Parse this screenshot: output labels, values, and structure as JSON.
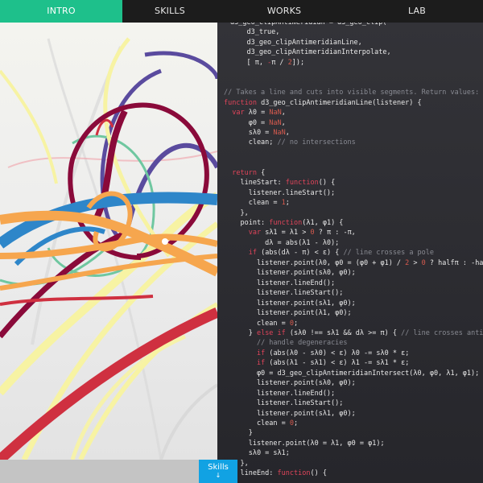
{
  "nav": {
    "tabs": [
      {
        "label": "INTRO",
        "active": true
      },
      {
        "label": "SKILLS",
        "active": false
      },
      {
        "label": "WORKS",
        "active": false
      },
      {
        "label": "LAB",
        "active": false
      }
    ],
    "active_color": "#1ec08b"
  },
  "colors": {
    "comment": "#888a92",
    "keyword": "#e0445a",
    "number": "#d65a4e",
    "default": "#e8e8e8",
    "palette": [
      "#8a0a3a",
      "#2e86c9",
      "#5a4b9e",
      "#f6a64e",
      "#f7f3a3",
      "#d9d9d9",
      "#cf3040",
      "#6fc7a0",
      "#f0a0a8"
    ]
  },
  "code_lines": [
    [
      [
        "default",
        "d3_geo_clipAntimeridian = d3_geo_clip("
      ]
    ],
    [
      [
        "default",
        "    d3_true,"
      ]
    ],
    [
      [
        "default",
        "    d3_geo_clipAntimeridianLine,"
      ]
    ],
    [
      [
        "default",
        "    d3_geo_clipAntimeridianInterpolate,"
      ]
    ],
    [
      [
        "default",
        "    [ π, "
      ],
      [
        "keyword",
        "-"
      ],
      [
        "default",
        "π / "
      ],
      [
        "number",
        "2"
      ],
      [
        "default",
        "]);"
      ]
    ],
    [],
    [],
    [
      [
        "comment",
        "// Takes a line and cuts into visible segments. Return values:"
      ]
    ],
    [
      [
        "keyword",
        "function"
      ],
      [
        "default",
        " d3_geo_clipAntimeridianLine(listener) {"
      ]
    ],
    [
      [
        "default",
        "  "
      ],
      [
        "keyword",
        "var"
      ],
      [
        "default",
        " λ0 = "
      ],
      [
        "number",
        "NaN"
      ],
      [
        "default",
        ","
      ]
    ],
    [
      [
        "default",
        "      φ0 = "
      ],
      [
        "number",
        "NaN"
      ],
      [
        "default",
        ","
      ]
    ],
    [
      [
        "default",
        "      sλ0 = "
      ],
      [
        "number",
        "NaN"
      ],
      [
        "default",
        ","
      ]
    ],
    [
      [
        "default",
        "      clean; "
      ],
      [
        "comment",
        "// no intersections"
      ]
    ],
    [],
    [],
    [
      [
        "default",
        "  "
      ],
      [
        "keyword",
        "return"
      ],
      [
        "default",
        " {"
      ]
    ],
    [
      [
        "default",
        "    lineStart: "
      ],
      [
        "keyword",
        "function"
      ],
      [
        "default",
        "() {"
      ]
    ],
    [
      [
        "default",
        "      listener.lineStart();"
      ]
    ],
    [
      [
        "default",
        "      clean = "
      ],
      [
        "number",
        "1"
      ],
      [
        "default",
        ";"
      ]
    ],
    [
      [
        "default",
        "    },"
      ]
    ],
    [
      [
        "default",
        "    point: "
      ],
      [
        "keyword",
        "function"
      ],
      [
        "default",
        "(λ1, φ1) {"
      ]
    ],
    [
      [
        "default",
        "      "
      ],
      [
        "keyword",
        "var"
      ],
      [
        "default",
        " sλ1 = λ1 > "
      ],
      [
        "number",
        "0"
      ],
      [
        "default",
        " ? π : -π,"
      ]
    ],
    [
      [
        "default",
        "          dλ = abs(λ1 - λ0);"
      ]
    ],
    [
      [
        "default",
        "      "
      ],
      [
        "keyword",
        "if"
      ],
      [
        "default",
        " (abs(dλ - π) < ε) { "
      ],
      [
        "comment",
        "// line crosses a pole"
      ]
    ],
    [
      [
        "default",
        "        listener.point(λ0, φ0 = (φ0 + φ1) / "
      ],
      [
        "number",
        "2"
      ],
      [
        "default",
        " > "
      ],
      [
        "number",
        "0"
      ],
      [
        "default",
        " ? halfπ : -halfπ);"
      ]
    ],
    [
      [
        "default",
        "        listener.point(sλ0, φ0);"
      ]
    ],
    [
      [
        "default",
        "        listener.lineEnd();"
      ]
    ],
    [
      [
        "default",
        "        listener.lineStart();"
      ]
    ],
    [
      [
        "default",
        "        listener.point(sλ1, φ0);"
      ]
    ],
    [
      [
        "default",
        "        listener.point(λ1, φ0);"
      ]
    ],
    [
      [
        "default",
        "        clean = "
      ],
      [
        "number",
        "0"
      ],
      [
        "default",
        ";"
      ]
    ],
    [
      [
        "default",
        "      } "
      ],
      [
        "keyword",
        "else if"
      ],
      [
        "default",
        " (sλ0 !== sλ1 && dλ >= π) { "
      ],
      [
        "comment",
        "// line crosses antimeridian"
      ]
    ],
    [
      [
        "default",
        "        "
      ],
      [
        "comment",
        "// handle degeneracies"
      ]
    ],
    [
      [
        "default",
        "        "
      ],
      [
        "keyword",
        "if"
      ],
      [
        "default",
        " (abs(λ0 - sλ0) < ε) λ0 -= sλ0 * ε;"
      ]
    ],
    [
      [
        "default",
        "        "
      ],
      [
        "keyword",
        "if"
      ],
      [
        "default",
        " (abs(λ1 - sλ1) < ε) λ1 -= sλ1 * ε;"
      ]
    ],
    [
      [
        "default",
        "        φ0 = d3_geo_clipAntimeridianIntersect(λ0, φ0, λ1, φ1);"
      ]
    ],
    [
      [
        "default",
        "        listener.point(sλ0, φ0);"
      ]
    ],
    [
      [
        "default",
        "        listener.lineEnd();"
      ]
    ],
    [
      [
        "default",
        "        listener.lineStart();"
      ]
    ],
    [
      [
        "default",
        "        listener.point(sλ1, φ0);"
      ]
    ],
    [
      [
        "default",
        "        clean = "
      ],
      [
        "number",
        "0"
      ],
      [
        "default",
        ";"
      ]
    ],
    [
      [
        "default",
        "      }"
      ]
    ],
    [
      [
        "default",
        "      listener.point(λ0 = λ1, φ0 = φ1);"
      ]
    ],
    [
      [
        "default",
        "      sλ0 = sλ1;"
      ]
    ],
    [
      [
        "default",
        "    },"
      ]
    ],
    [
      [
        "default",
        "    lineEnd: "
      ],
      [
        "keyword",
        "function"
      ],
      [
        "default",
        "() {"
      ]
    ]
  ],
  "skills_button": {
    "label": "Skills",
    "arrow": "↓"
  }
}
